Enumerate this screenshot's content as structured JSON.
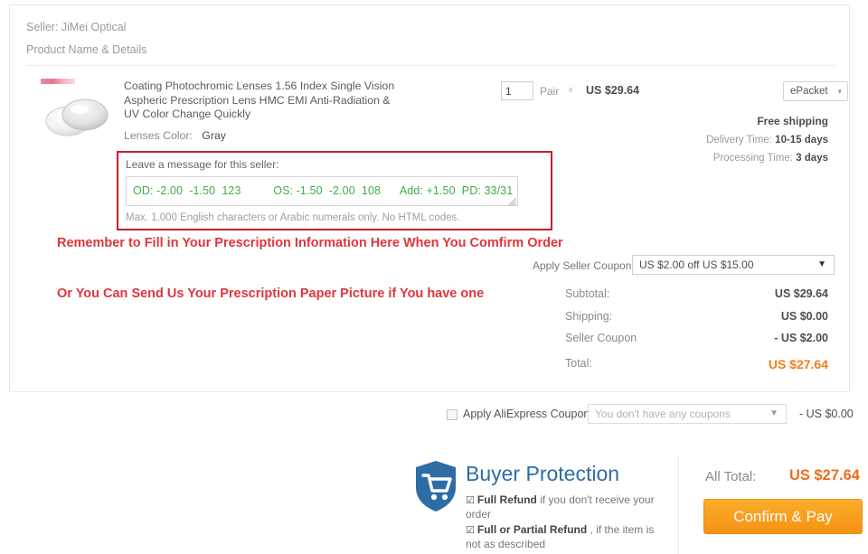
{
  "card": {
    "seller_line": "Seller: JiMei Optical",
    "product_name_details": "Product Name & Details",
    "product": {
      "title": "Coating Photochromic Lenses 1.56 Index Single Vision Aspheric Prescription Lens HMC EMI Anti-Radiation & UV Color Change Quickly",
      "attr_label": "Lenses Color:",
      "attr_value": "Gray",
      "badge": "promo-badge"
    },
    "quantity": {
      "value": "1",
      "unit": "Pair",
      "multiply": "×",
      "unit_price": "US $29.64"
    },
    "shipping": {
      "method": "ePacket",
      "free_shipping": "Free shipping",
      "delivery_time_label": "Delivery Time:",
      "delivery_time_value": "10-15 days",
      "processing_time_label": "Processing Time:",
      "processing_time_value": "3 days"
    },
    "message": {
      "label": "Leave a message for this seller:",
      "value": "OD: -2.00  -1.50  123          OS: -1.50  -2.00  108      Add: +1.50  PD: 33/31",
      "hint": "Max. 1,000 English characters or Arabic numerals only. No HTML codes."
    },
    "annotations": {
      "line1": "Remember to Fill in Your Prescription Information Here When You Comfirm Order",
      "line2": "Or You Can Send Us Your Prescription Paper Picture if You have one",
      "color": "#e0353c"
    },
    "seller_coupon": {
      "label": "Apply Seller Coupon:",
      "selected": "US $2.00 off US $15.00"
    },
    "totals": [
      {
        "label": "Subtotal:",
        "value": "US $29.64"
      },
      {
        "label": "Shipping:",
        "value": "US $0.00"
      },
      {
        "label": "Seller Coupon",
        "value": "- US $2.00"
      },
      {
        "label": "Total:",
        "value": "US $27.64"
      }
    ]
  },
  "ae_coupon": {
    "label": "Apply AliExpress Coupon:",
    "placeholder": "You don't have any coupons",
    "amount": "- US $0.00",
    "checked": false
  },
  "buyer_protection": {
    "title": "Buyer Protection",
    "title_color": "#2e6ca6",
    "item1_bold": "Full Refund",
    "item1_rest": " if you don't receive your order",
    "item2_bold": "Full or Partial Refund",
    "item2_rest": " , if the item is not as described",
    "tick": "☑"
  },
  "checkout": {
    "all_total_label": "All Total:",
    "all_total_value": "US $27.64",
    "pay_button": "Confirm & Pay",
    "accent_color": "#ef6c1a"
  },
  "icons": {
    "caret_down_small": "▾",
    "caret_down": "▼"
  }
}
